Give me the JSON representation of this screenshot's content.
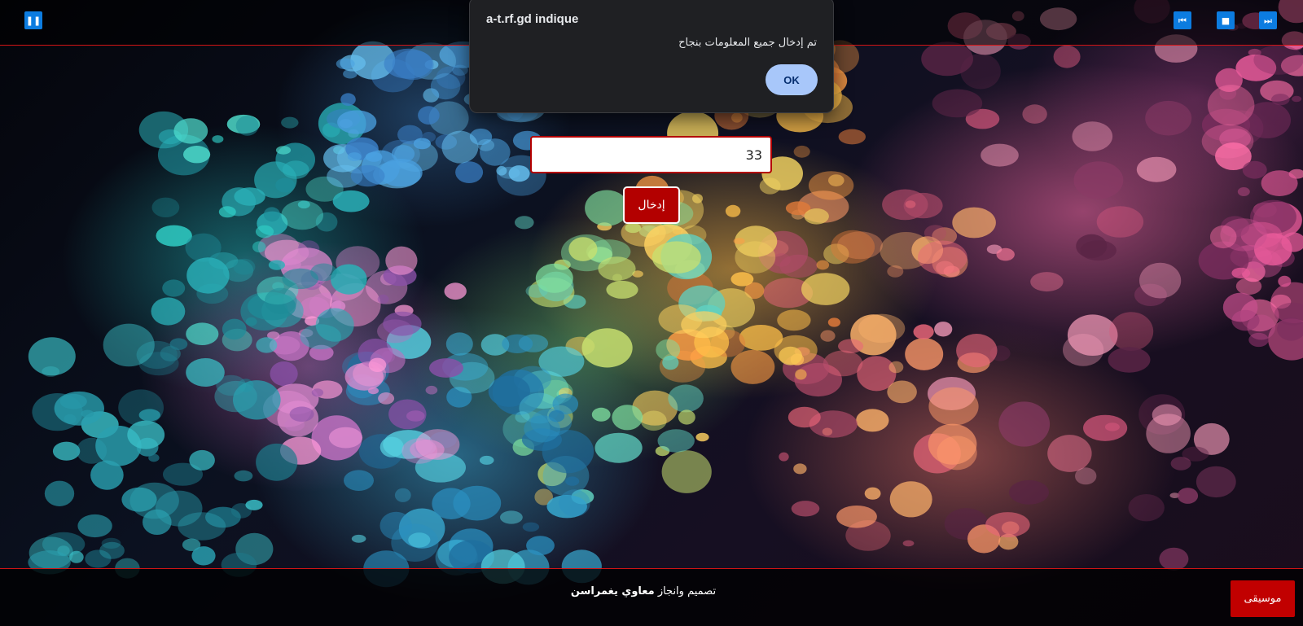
{
  "colors": {
    "accent_red": "#c10000",
    "control_blue": "#0c7ce0",
    "dialog_bg": "#1f2023",
    "dialog_button": "#a8c7fa"
  },
  "player": {
    "pause_icon": "pause-icon",
    "prev_icon": "skip-previous-icon",
    "stop_icon": "stop-icon",
    "next_icon": "skip-next-icon",
    "pause_glyph": "❚❚",
    "prev_glyph": "⏮",
    "stop_glyph": "■",
    "next_glyph": "⏭"
  },
  "form": {
    "input_value": "33",
    "submit_label": "إدخال"
  },
  "footer": {
    "credit_prefix": "تصميم وانجاز",
    "credit_name": "معاوي يغمراسن",
    "music_label": "موسيقى"
  },
  "dialog": {
    "title": "a-t.rf.gd indique",
    "message": "تم إدخال جميع المعلومات بنجاح",
    "ok_label": "OK"
  }
}
